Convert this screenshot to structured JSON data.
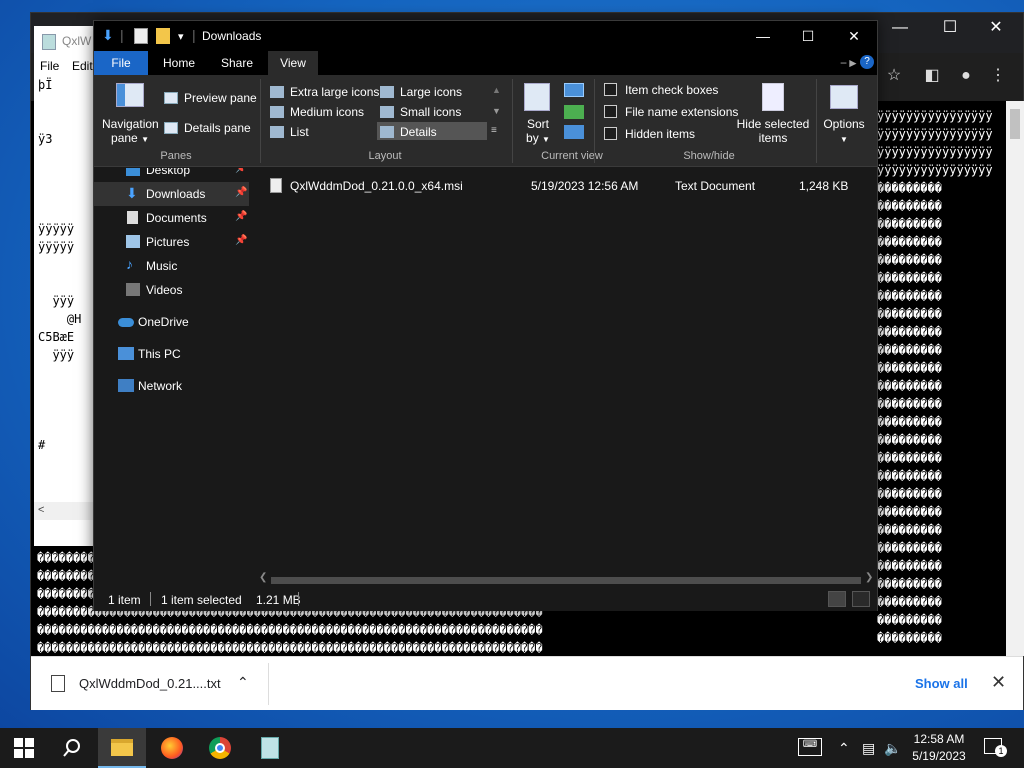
{
  "explorer": {
    "title": "Downloads",
    "tabs": [
      {
        "label": "File"
      },
      {
        "label": "Home"
      },
      {
        "label": "Share"
      },
      {
        "label": "View"
      }
    ],
    "ribbon": {
      "panes": {
        "navigation_pane": "Navigation",
        "navigation_pane_2": "pane",
        "preview_pane": "Preview pane",
        "details_pane": "Details pane",
        "group_label": "Panes"
      },
      "layout": {
        "items": [
          "Extra large icons",
          "Large icons",
          "Medium icons",
          "Small icons",
          "List",
          "Details"
        ],
        "group_label": "Layout"
      },
      "current_view": {
        "sort_by": "Sort",
        "sort_by_2": "by",
        "group_label": "Current view"
      },
      "show_hide": {
        "item_check_boxes": "Item check boxes",
        "file_name_extensions": "File name extensions",
        "hidden_items": "Hidden items",
        "hide_selected": "Hide selected",
        "hide_selected_2": "items",
        "group_label": "Show/hide"
      },
      "options": "Options"
    },
    "nav": [
      {
        "label": "Desktop"
      },
      {
        "label": "Downloads"
      },
      {
        "label": "Documents"
      },
      {
        "label": "Pictures"
      },
      {
        "label": "Music"
      },
      {
        "label": "Videos"
      },
      {
        "label": "OneDrive"
      },
      {
        "label": "This PC"
      },
      {
        "label": "Network"
      }
    ],
    "file": {
      "name": "QxlWddmDod_0.21.0.0_x64.msi",
      "date": "5/19/2023 12:56 AM",
      "type": "Text Document",
      "size": "1,248 KB"
    },
    "status": {
      "count": "1 item",
      "selected": "1 item selected",
      "size": "1.21 MB"
    }
  },
  "chrome": {
    "download_item": "QxlWddmDod_0.21....txt",
    "show_all": "Show all"
  },
  "notepad": {
    "title": "QxlW",
    "menu_file": "File",
    "menu_edit": "Edit"
  },
  "taskbar": {
    "time": "12:58 AM",
    "date": "5/19/2023",
    "notifications": "1"
  },
  "colors": {
    "accent": "#1a66c7",
    "link": "#1a73e8"
  }
}
